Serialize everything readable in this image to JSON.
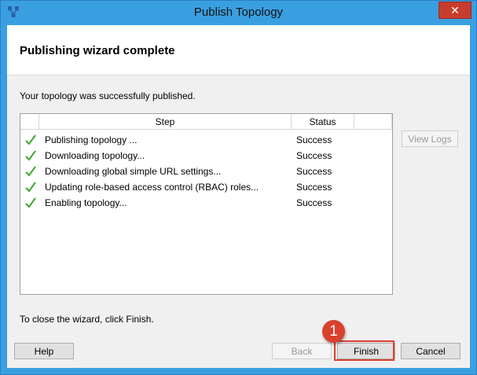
{
  "window": {
    "title": "Publish Topology",
    "close_glyph": "✕"
  },
  "header": {
    "title": "Publishing wizard complete"
  },
  "message": "Your topology was successfully published.",
  "table": {
    "columns": [
      "Step",
      "Status"
    ],
    "rows": [
      {
        "step": "Publishing topology ...",
        "status": "Success"
      },
      {
        "step": "Downloading topology...",
        "status": "Success"
      },
      {
        "step": "Downloading global simple URL settings...",
        "status": "Success"
      },
      {
        "step": "Updating role-based access control (RBAC) roles...",
        "status": "Success"
      },
      {
        "step": "Enabling topology...",
        "status": "Success"
      }
    ]
  },
  "buttons": {
    "view_logs": "View Logs",
    "help": "Help",
    "back": "Back",
    "finish": "Finish",
    "cancel": "Cancel"
  },
  "close_instruction": "To close the wizard, click Finish.",
  "annotation": {
    "badge": "1"
  },
  "colors": {
    "accent": "#3a9fe0",
    "callout": "#d9412d",
    "check": "#3aa82f"
  }
}
